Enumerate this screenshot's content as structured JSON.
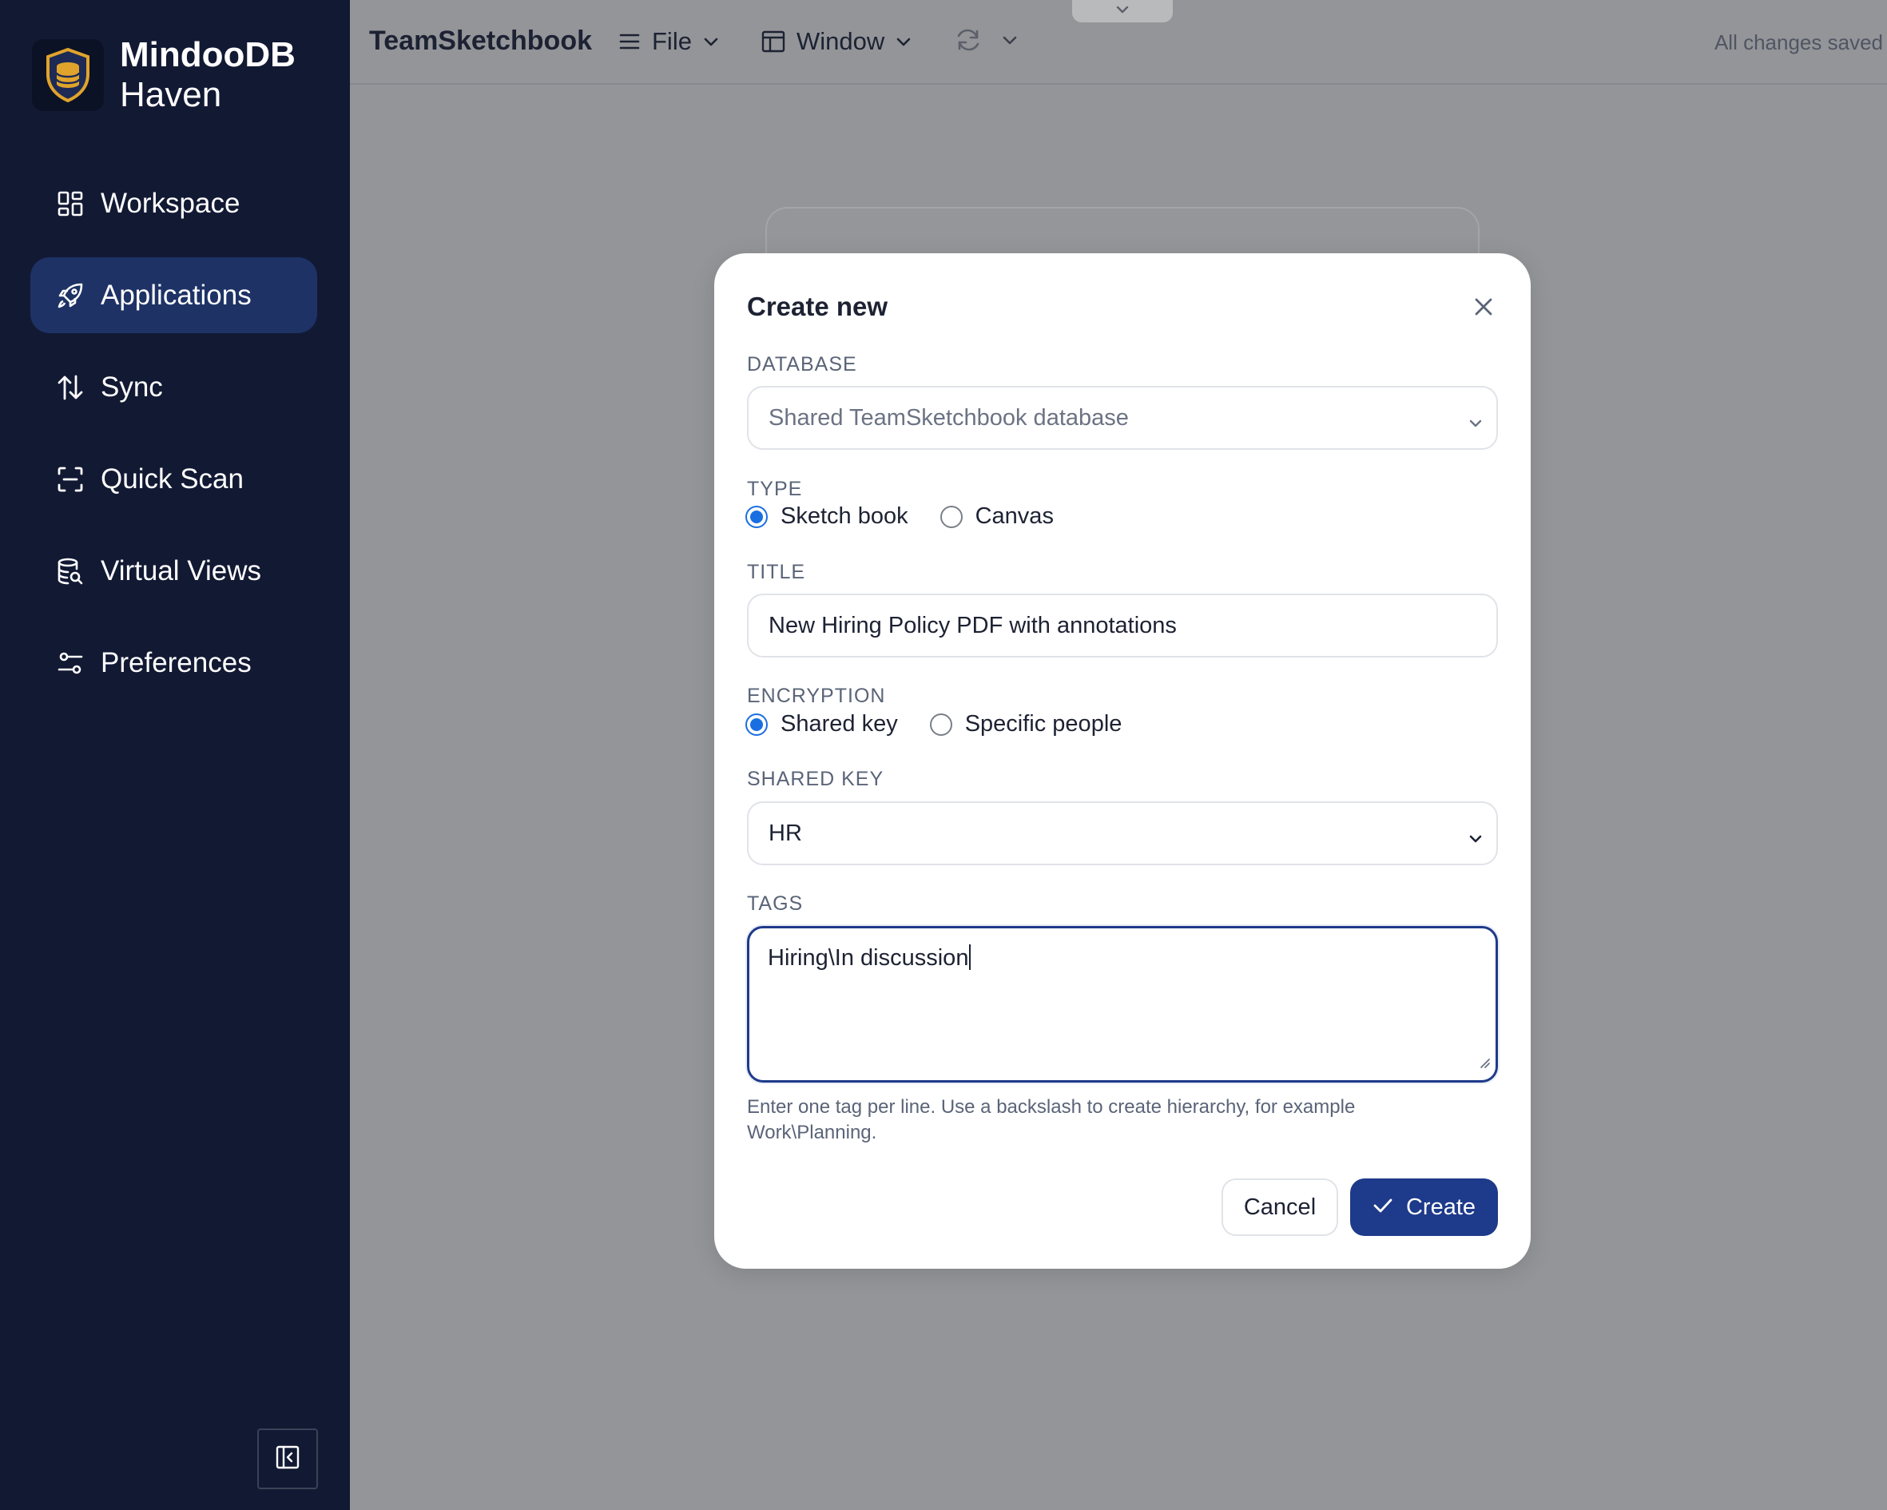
{
  "app": {
    "brand_line1": "MindooDB",
    "brand_line2": "Haven",
    "title": "TeamSketchbook",
    "status": "All changes saved"
  },
  "sidebar": {
    "items": [
      {
        "label": "Workspace",
        "icon": "grid-icon"
      },
      {
        "label": "Applications",
        "icon": "rocket-icon",
        "active": true
      },
      {
        "label": "Sync",
        "icon": "sync-arrows-icon"
      },
      {
        "label": "Quick Scan",
        "icon": "scan-icon"
      },
      {
        "label": "Virtual Views",
        "icon": "database-search-icon"
      },
      {
        "label": "Preferences",
        "icon": "sliders-icon"
      }
    ]
  },
  "menus": {
    "file": "File",
    "window": "Window"
  },
  "dialog": {
    "title": "Create new",
    "database_label": "DATABASE",
    "database_placeholder": "Shared TeamSketchbook database",
    "type_label": "TYPE",
    "type_options": [
      "Sketch book",
      "Canvas"
    ],
    "type_selected": "Sketch book",
    "title_label": "TITLE",
    "title_value": "New Hiring Policy PDF with annotations",
    "encryption_label": "ENCRYPTION",
    "encryption_options": [
      "Shared key",
      "Specific people"
    ],
    "encryption_selected": "Shared key",
    "shared_key_label": "SHARED KEY",
    "shared_key_value": "HR",
    "tags_label": "TAGS",
    "tags_value": "Hiring\\In discussion",
    "tags_hint": "Enter one tag per line. Use a backslash to create hierarchy, for example Work\\Planning.",
    "cancel_label": "Cancel",
    "create_label": "Create"
  },
  "colors": {
    "sidebar_bg": "#121933",
    "active_nav": "#1e3265",
    "primary": "#1e3a8a",
    "radio": "#1a6fe0",
    "overlay": "#939598"
  }
}
